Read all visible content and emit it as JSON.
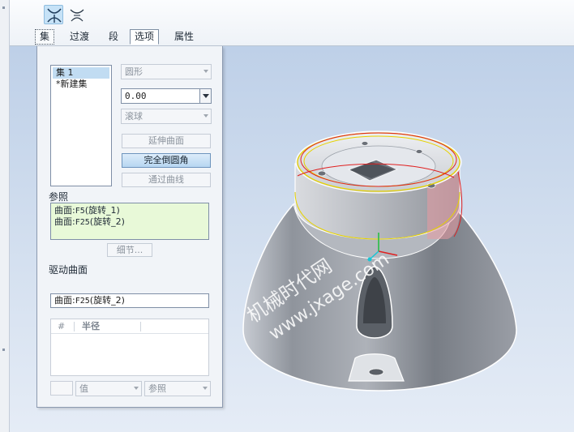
{
  "toolbar": {
    "icons": [
      "surface-tool-icon",
      "surface-alt-tool-icon"
    ]
  },
  "tabs": [
    {
      "label": "集",
      "state": "focused"
    },
    {
      "label": "过渡"
    },
    {
      "label": "段"
    },
    {
      "label": "选项",
      "state": "active"
    },
    {
      "label": "属性"
    }
  ],
  "panel": {
    "sets": [
      "集 1",
      "*新建集"
    ],
    "shape_combo": "圆形",
    "radius_value": "0.00",
    "method_combo": "滚球",
    "buttons": {
      "extend_surface": "延伸曲面",
      "full_round": "完全倒圆角",
      "through_curve": "通过曲线",
      "details": "细节..."
    },
    "references_label": "参照",
    "references": [
      {
        "prefix": "曲面:",
        "id": "F5",
        "name": "(旋转_1)"
      },
      {
        "prefix": "曲面:",
        "id": "F25",
        "name": "(旋转_2)"
      }
    ],
    "driving_surface_label": "驱动曲面",
    "driving_surface": {
      "prefix": "曲面:",
      "id": "F25",
      "name": "(旋转_2)"
    },
    "table": {
      "headers": [
        "#",
        "半径"
      ]
    },
    "bottom_combos": {
      "value": "值",
      "reference": "参照"
    }
  },
  "watermark": {
    "line1": "机械时代网",
    "line2": "www.jxage.com"
  },
  "colors": {
    "accent": "#c6e2f7",
    "reference_bg": "#e8f9d8",
    "edge_red": "#e02020",
    "edge_yellow": "#e6d200"
  }
}
